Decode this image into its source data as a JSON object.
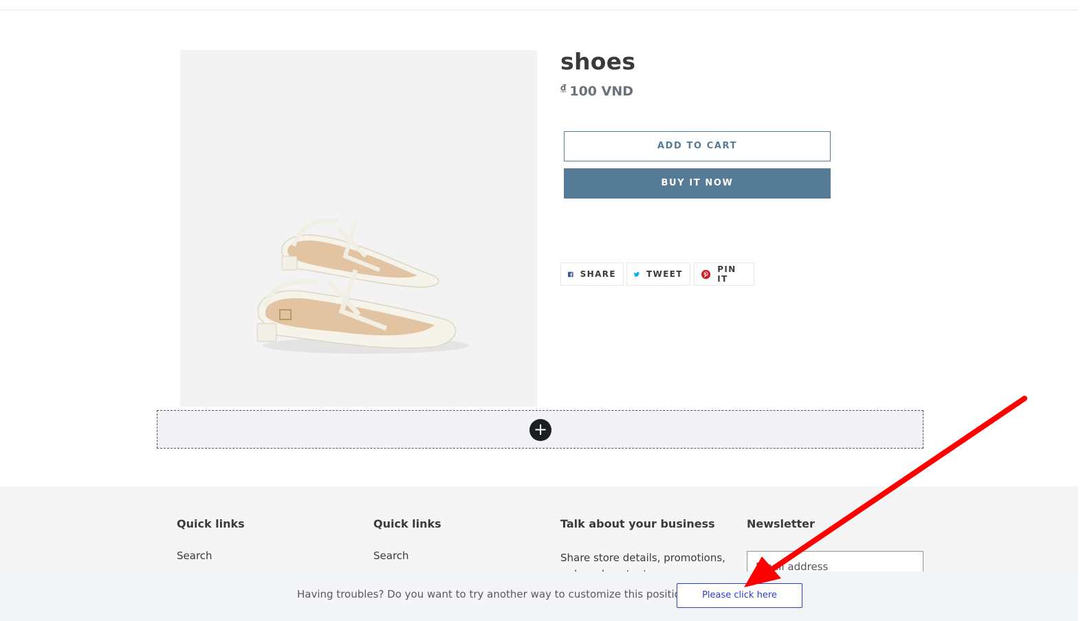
{
  "product": {
    "title": "shoes",
    "price_symbol": "₫",
    "price": "100 VND",
    "add_to_cart": "ADD TO CART",
    "buy_now": "BUY IT NOW"
  },
  "share": {
    "facebook": "SHARE",
    "twitter": "TWEET",
    "pinterest": "PIN IT"
  },
  "editor": {
    "add_section_symbol": "+"
  },
  "footer": {
    "col1": {
      "title": "Quick links",
      "link": "Search"
    },
    "col2": {
      "title": "Quick links",
      "link": "Search"
    },
    "col3": {
      "title": "Talk about your business",
      "text": "Share store details, promotions, or brand content"
    },
    "col4": {
      "title": "Newsletter",
      "email_placeholder": "Email address"
    }
  },
  "trouble_bar": {
    "message": "Having troubles? Do you want to try another way to customize this position?",
    "button": "Please click here"
  },
  "colors": {
    "accent": "#557b97",
    "annotation_arrow": "#ff0000",
    "link_button": "#2c3fbf"
  },
  "icons": {
    "facebook": "facebook-icon",
    "twitter": "twitter-icon",
    "pinterest": "pinterest-icon",
    "add": "plus-icon"
  }
}
